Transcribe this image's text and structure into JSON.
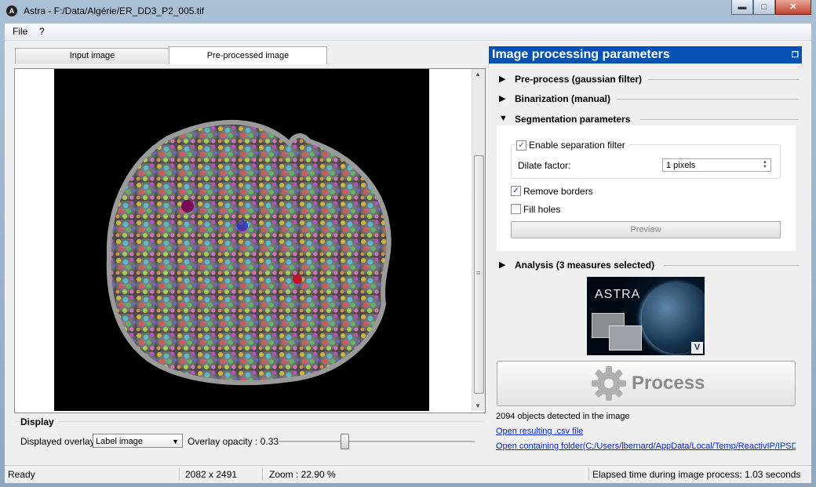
{
  "window": {
    "title": "Astra - F:/Data/Algérie/ER_DD3_P2_005.tif",
    "app_icon": "A",
    "minimize": "▬",
    "maximize": "□",
    "close": "✕"
  },
  "menu": {
    "file": "File",
    "help": "?"
  },
  "tabs": [
    {
      "label": "Input image"
    },
    {
      "label": "Pre-processed image"
    }
  ],
  "display": {
    "title": "Display",
    "overlay_label": "Displayed overlay",
    "overlay_value": "Label image",
    "opacity_label": "Overlay opacity : 0.33",
    "opacity_value": 0.33
  },
  "status": {
    "ready": "Ready",
    "size": "2082 x 2491",
    "zoom": "Zoom : 22.90 %",
    "elapsed": "Elapsed time during image process: 1.03 seconds"
  },
  "panel": {
    "title": "Image processing parameters",
    "sections": [
      {
        "title": "Pre-process (gaussian filter)",
        "expanded": false
      },
      {
        "title": "Binarization (manual)",
        "expanded": false
      },
      {
        "title": "Segmentation parameters",
        "expanded": true
      },
      {
        "title": "Analysis (3 measures selected)",
        "expanded": false
      }
    ],
    "segmentation": {
      "enable_label": "Enable separation filter",
      "dilate_label": "Dilate factor:",
      "dilate_value": "1 pixels",
      "remove_borders": "Remove borders",
      "fill_holes": "Fill holes",
      "preview": "Preview"
    },
    "logo": {
      "text": "ASTRA",
      "badge": "V"
    },
    "process": "Process",
    "objects_detected": "2094 objects detected in the image",
    "open_csv": "Open resulting .csv file",
    "open_folder": "Open containing folder(C:/Users/lbernard/AppData/Local/Temp/ReactivIP/IPSDK"
  }
}
